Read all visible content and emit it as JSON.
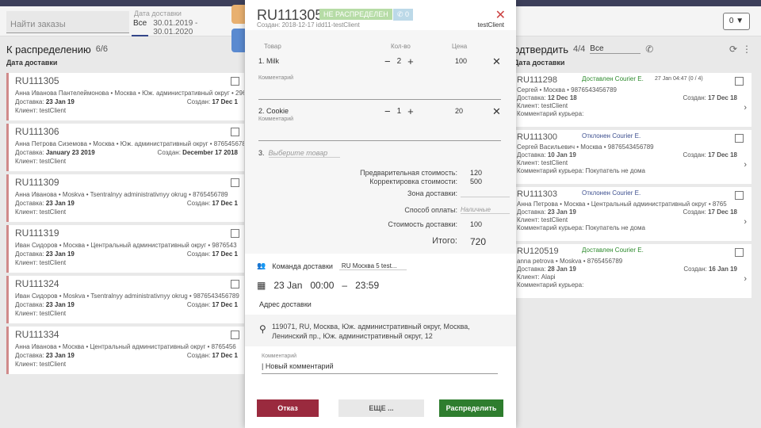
{
  "filters": {
    "search_placeholder": "Найти заказы",
    "date_label": "Дата доставки",
    "date_all": "Все",
    "date_range": "30.01.2019 - 30.01.2020",
    "filter_count": "0"
  },
  "left_col": {
    "title": "К распределению",
    "count": "6/6",
    "sort": "Дата доставки",
    "cards": [
      {
        "id": "RU111305",
        "line": "Анна Иванова Пантелеймонова  •  Москва  •  Юж. административный округ  •  2965",
        "delivery_label": "Доставка:",
        "delivery": "23 Jan 19",
        "created_label": "Создан:",
        "created": "17 Dec 1",
        "client": "Клиент: testClient"
      },
      {
        "id": "RU111306",
        "line": "Анна Петрова Сиземова  •  Москва  •  Юж. административный округ  •  8765456789",
        "delivery_label": "Доставка:",
        "delivery": "January 23 2019",
        "created_label": "Создан:",
        "created": "December 17 2018",
        "client": "Клиент: testClient"
      },
      {
        "id": "RU111309",
        "line": "Анна Иванова  •  Moskva  •  Tsentralnyy administrativnyy okrug  •  8765456789",
        "delivery_label": "Доставка:",
        "delivery": "23 Jan 19",
        "created_label": "Создан:",
        "created": "17 Dec 1",
        "client": "Клиент: testClient"
      },
      {
        "id": "RU111319",
        "line": "Иван Сидоров  •  Москва  •  Центральный административный округ  •  9876543",
        "delivery_label": "Доставка:",
        "delivery": "23 Jan 19",
        "created_label": "Создан:",
        "created": "17 Dec 1",
        "client": "Клиент: testClient"
      },
      {
        "id": "RU111324",
        "line": "Иван Сидоров  •  Moskva  •  Tsentralnyy administrativnyy okrug  •  9876543456789",
        "delivery_label": "Доставка:",
        "delivery": "23 Jan 19",
        "created_label": "Создан:",
        "created": "17 Dec 1",
        "client": "Клиент: testClient"
      },
      {
        "id": "RU111334",
        "line": "Анна Иванова  •  Москва  •  Центральный административный округ  •  8765456",
        "delivery_label": "Доставка:",
        "delivery": "23 Jan 19",
        "created_label": "Создан:",
        "created": "17 Dec 1",
        "client": "Клиент: testClient"
      }
    ]
  },
  "right_col": {
    "title": "одтвердить",
    "count": "4/4",
    "filter": "Все",
    "sort": "Дата доставки",
    "cards": [
      {
        "id": "RU111298",
        "status": "Доставлен Courier E.",
        "status_color": "#2e8b2e",
        "extra": "27 Jan 04:47   (0 / 4)",
        "line": "Сергей  •  Москва  •  9876543456789",
        "delivery_label": "Доставка:",
        "delivery": "12 Dec 18",
        "created_label": "Создан:",
        "created": "17 Dec 18",
        "client": "Клиент: testClient",
        "courier_comment": "Комментарий курьера:"
      },
      {
        "id": "RU111300",
        "status": "Отклонен Courier E.",
        "status_color": "#3d4f8f",
        "extra": "",
        "line": "Сергей Васильевич  •  Москва  •  9876543456789",
        "delivery_label": "Доставка:",
        "delivery": "10 Jan 19",
        "created_label": "Создан:",
        "created": "17 Dec 18",
        "client": "Клиент: testClient",
        "courier_comment": "Комментарий курьера: Покупатель не дома"
      },
      {
        "id": "RU111303",
        "status": "Отклонен Courier E.",
        "status_color": "#3d4f8f",
        "extra": "",
        "line": "Анна Петрова  •  Москва  •  Центральный административный округ  •  8765",
        "delivery_label": "Доставка:",
        "delivery": "23 Jan 19",
        "created_label": "Создан:",
        "created": "17 Dec 18",
        "client": "Клиент: testClient",
        "courier_comment": "Комментарий курьера: Покупатель не дома"
      },
      {
        "id": "RU120519",
        "status": "Доставлен Courier E.",
        "status_color": "#2e8b2e",
        "extra": "",
        "line": "anna petrova  •  Moskva  •  8765456789",
        "delivery_label": "Доставка:",
        "delivery": "28 Jan 19",
        "created_label": "Создан:",
        "created": "16 Jan 19",
        "client": "Клиент: Alapi",
        "courier_comment": "Комментарий курьера:"
      }
    ]
  },
  "modal": {
    "order_id": "RU111305",
    "status_badge": "НЕ РАСПРЕДЕЛЕН",
    "phone_badge": "0",
    "created": "Создан: 2018-12-17   idd11-testClient",
    "client": "testClient",
    "headers": {
      "product": "Товар",
      "qty": "Кол-во",
      "price": "Цена"
    },
    "items": [
      {
        "name": "1. Milk",
        "qty": "2",
        "price": "100",
        "comment_label": "Комментарий"
      },
      {
        "name": "2. Cookie",
        "qty": "1",
        "price": "20",
        "comment_label": "Комментарий"
      }
    ],
    "select_num": "3.",
    "select_placeholder": "Выберите товар",
    "summary": {
      "prelim_label": "Предварительная стоимость:",
      "prelim": "120",
      "correction_label": "Корректировка стоимости:",
      "correction": "500",
      "zone_label": "Зона доставки:",
      "payment_label": "Способ оплаты:",
      "payment": "Наличные",
      "delivery_cost_label": "Стоимость доставки:",
      "delivery_cost": "100",
      "total_label": "Итого:",
      "total": "720"
    },
    "team_label": "Команда доставки",
    "team_value": "RU Москва 5 test...",
    "date": "23 Jan",
    "time_from": "00:00",
    "time_to": "23:59",
    "address_label": "Адрес доставки",
    "address": "119071, RU, Москва, Юж. административный округ, Москва, Ленинский пр., Юж. административный округ, 12",
    "comment_label": "Комментарий",
    "comment": "| Новый комментарий",
    "btn_reject": "Отказ",
    "btn_more": "ЕЩЕ ...",
    "btn_assign": "Распределить"
  }
}
